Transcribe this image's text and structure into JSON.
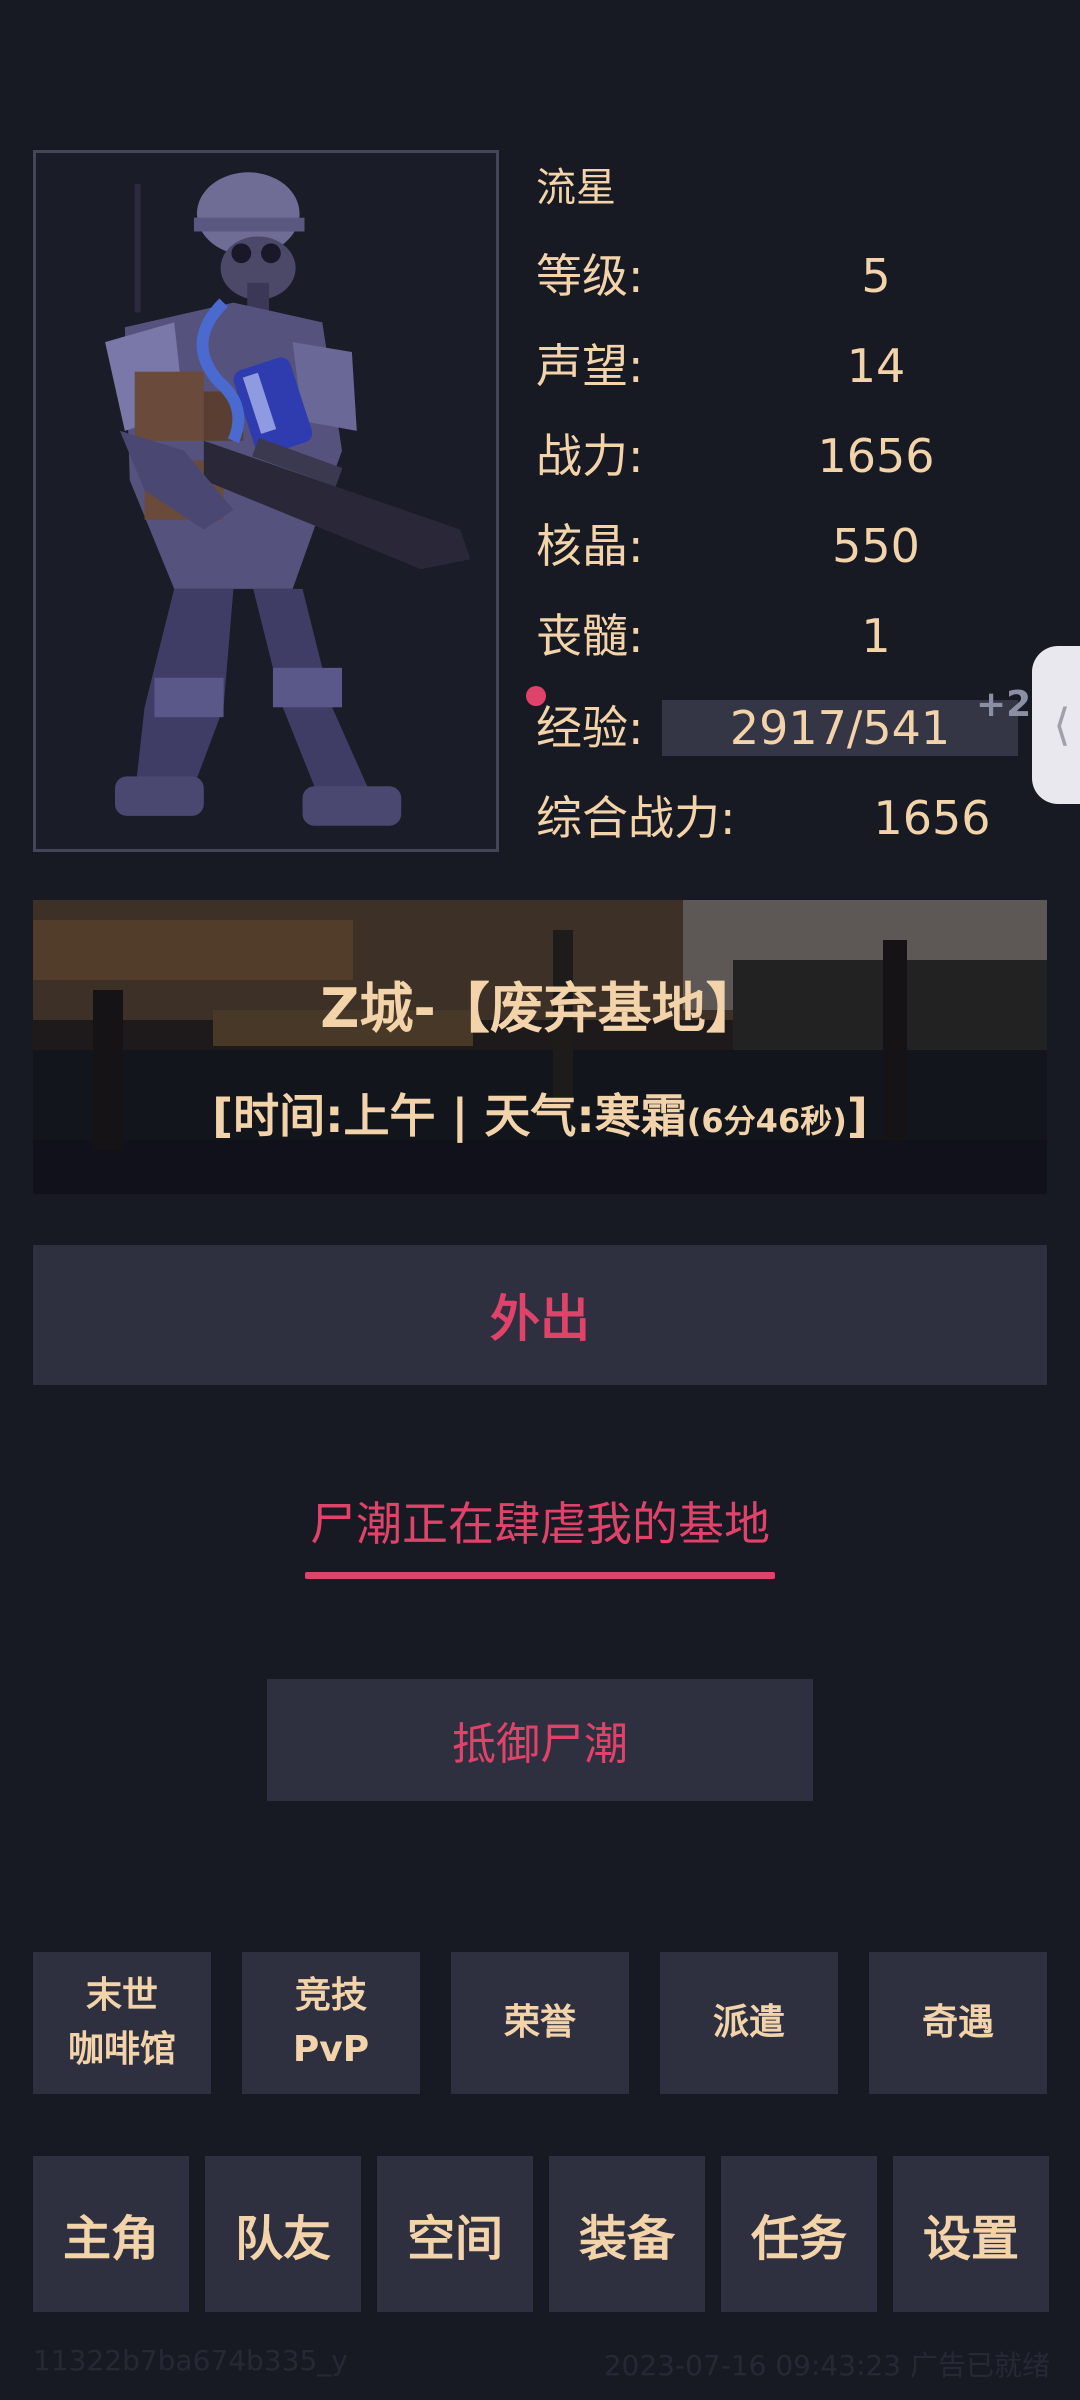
{
  "player": {
    "name": "流星",
    "level_label": "等级:",
    "level": "5",
    "prestige_label": "声望:",
    "prestige": "14",
    "power_label": "战力:",
    "power": "1656",
    "core_label": "核晶:",
    "core": "550",
    "marrow_label": "丧髓:",
    "marrow": "1",
    "exp_label": "经验:",
    "exp": "2917/541",
    "exp_gain": "+2",
    "total_power_label": "综合战力:",
    "total_power": "1656"
  },
  "side_tab": {
    "icon": "chevron-left-icon",
    "glyph": "⟨"
  },
  "location": {
    "name": "Z城-【废弃基地】",
    "status_prefix": "[时间:上午 | 天气:寒霜",
    "status_timer": "(6分46秒)",
    "status_suffix": "]"
  },
  "actions": {
    "go_out": "外出",
    "alert": "尸潮正在肆虐我的基地",
    "defend": "抵御尸潮"
  },
  "menu_row1": [
    {
      "line1": "末世",
      "line2": "咖啡馆"
    },
    {
      "line1": "竞技",
      "line2": "PvP"
    },
    {
      "line1": "荣誉",
      "line2": ""
    },
    {
      "line1": "派遣",
      "line2": ""
    },
    {
      "line1": "奇遇",
      "line2": ""
    }
  ],
  "menu_row2": [
    "主角",
    "队友",
    "空间",
    "装备",
    "任务",
    "设置"
  ],
  "footer": {
    "left": "11322b7ba674b335_y",
    "right": "2023-07-16 09:43:23 广告已就绪"
  },
  "colors": {
    "background": "#181a23",
    "button": "#2e303f",
    "accent_red": "#e0436a",
    "text_cream": "#f2d3aa"
  }
}
